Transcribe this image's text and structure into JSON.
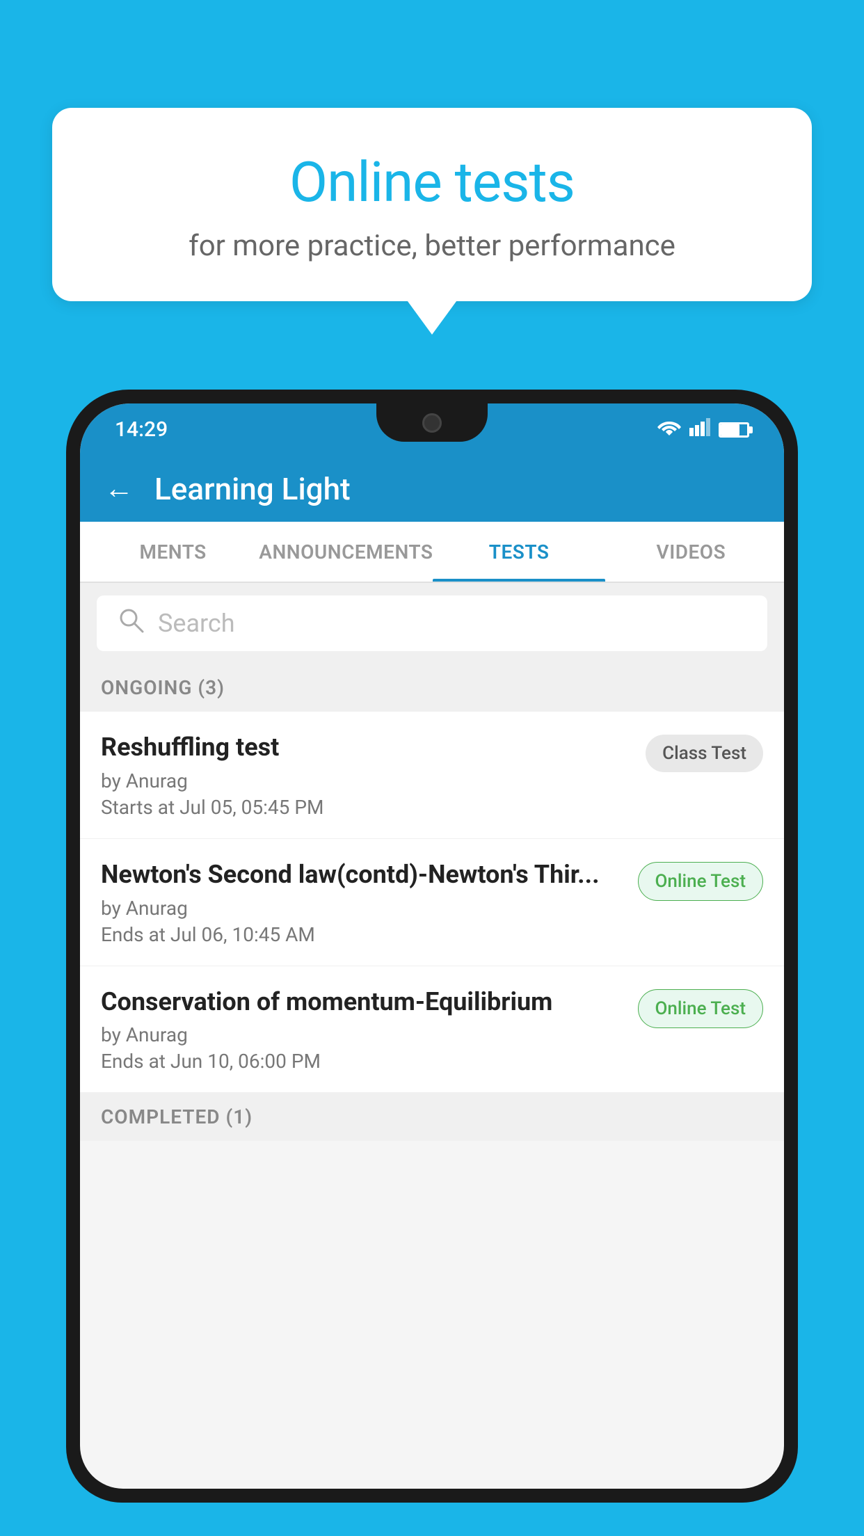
{
  "background_color": "#1ab5e8",
  "speech_bubble": {
    "title": "Online tests",
    "subtitle": "for more practice, better performance"
  },
  "phone": {
    "status_bar": {
      "time": "14:29",
      "wifi": "wifi",
      "signal": "signal",
      "battery": "battery"
    },
    "header": {
      "back_label": "←",
      "title": "Learning Light"
    },
    "tabs": [
      {
        "id": "ments",
        "label": "MENTS",
        "active": false
      },
      {
        "id": "announcements",
        "label": "ANNOUNCEMENTS",
        "active": false
      },
      {
        "id": "tests",
        "label": "TESTS",
        "active": true
      },
      {
        "id": "videos",
        "label": "VIDEOS",
        "active": false
      }
    ],
    "search": {
      "placeholder": "Search"
    },
    "ongoing_section": {
      "label": "ONGOING (3)"
    },
    "test_items": [
      {
        "id": "test-1",
        "title": "Reshuffling test",
        "by": "by Anurag",
        "time_label": "Starts at",
        "time": "Jul 05, 05:45 PM",
        "badge_text": "Class Test",
        "badge_type": "class"
      },
      {
        "id": "test-2",
        "title": "Newton's Second law(contd)-Newton's Thir...",
        "by": "by Anurag",
        "time_label": "Ends at",
        "time": "Jul 06, 10:45 AM",
        "badge_text": "Online Test",
        "badge_type": "online"
      },
      {
        "id": "test-3",
        "title": "Conservation of momentum-Equilibrium",
        "by": "by Anurag",
        "time_label": "Ends at",
        "time": "Jun 10, 06:00 PM",
        "badge_text": "Online Test",
        "badge_type": "online"
      }
    ],
    "completed_section": {
      "label": "COMPLETED (1)"
    }
  }
}
